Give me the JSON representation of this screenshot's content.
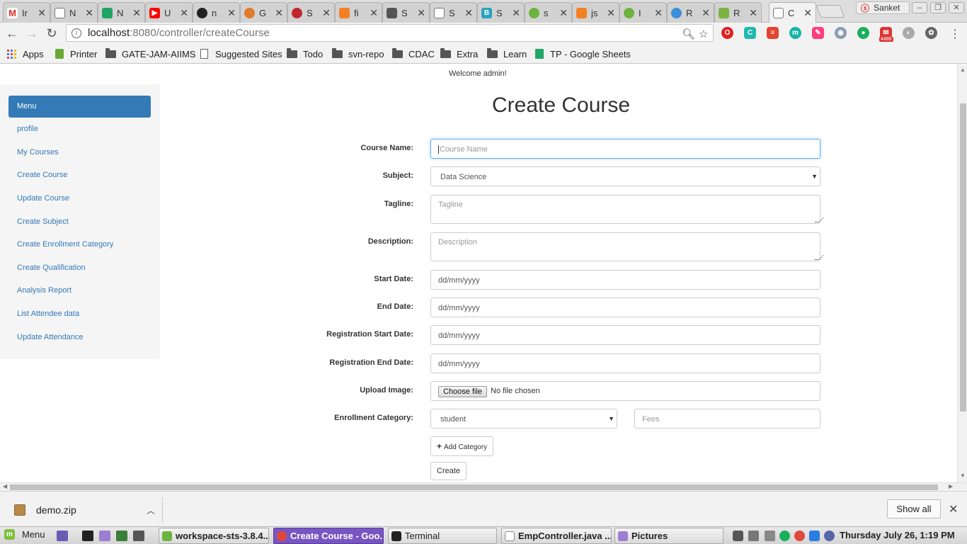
{
  "browser": {
    "tabs": [
      {
        "title": "Ir",
        "favicon": "gmail-icon",
        "color": "#d93025"
      },
      {
        "title": "N",
        "favicon": "page-icon",
        "color": "#888888"
      },
      {
        "title": "N",
        "favicon": "drive-icon",
        "color": "#1fa463"
      },
      {
        "title": "U",
        "favicon": "youtube-icon",
        "color": "#ff0000"
      },
      {
        "title": "n",
        "favicon": "github-icon",
        "color": "#222222"
      },
      {
        "title": "G",
        "favicon": "generic-icon",
        "color": "#e07b2a"
      },
      {
        "title": "S",
        "favicon": "generic-icon",
        "color": "#c0272d"
      },
      {
        "title": "fi",
        "favicon": "stackoverflow-icon",
        "color": "#f48024"
      },
      {
        "title": "S",
        "favicon": "generic-icon",
        "color": "#555555"
      },
      {
        "title": "S",
        "favicon": "page-icon",
        "color": "#888888"
      },
      {
        "title": "S",
        "favicon": "generic-icon",
        "color": "#2aa1c0"
      },
      {
        "title": "s",
        "favicon": "spring-icon",
        "color": "#6db33f"
      },
      {
        "title": "js",
        "favicon": "stackoverflow-icon",
        "color": "#f48024"
      },
      {
        "title": "I",
        "favicon": "spring-icon",
        "color": "#6db33f"
      },
      {
        "title": "R",
        "favicon": "generic-icon",
        "color": "#3b8fd8"
      },
      {
        "title": "R",
        "favicon": "generic-icon",
        "color": "#7cb342"
      },
      {
        "title": "C",
        "favicon": "page-icon",
        "color": "#888888"
      }
    ],
    "profile_name": "Sanket",
    "url_host": "localhost",
    "url_path": ":8080/controller/createCourse",
    "bookmarks": [
      {
        "label": "Apps",
        "icon": "apps-icon"
      },
      {
        "label": "Printer",
        "icon": "printer-icon"
      },
      {
        "label": "GATE-JAM-AIIMS",
        "icon": "folder-icon"
      },
      {
        "label": "Suggested Sites",
        "icon": "page-icon"
      },
      {
        "label": "Todo",
        "icon": "folder-icon"
      },
      {
        "label": "svn-repo",
        "icon": "folder-icon"
      },
      {
        "label": "CDAC",
        "icon": "folder-icon"
      },
      {
        "label": "Extra",
        "icon": "folder-icon"
      },
      {
        "label": "Learn",
        "icon": "folder-icon"
      },
      {
        "label": "TP - Google Sheets",
        "icon": "sheets-icon"
      }
    ],
    "mail_badge": "4488"
  },
  "page": {
    "welcome": "Welcome admin!",
    "title": "Create Course",
    "sidebar": {
      "header": "Menu",
      "links": [
        "profile",
        "My Courses",
        "Create Course",
        "Update Course",
        "Create Subject",
        "Create Enrollment Category",
        "Create Qualification",
        "Analysis Report",
        "List Attendee data",
        "Update Attendance"
      ]
    },
    "form": {
      "course_name_label": "Course Name:",
      "course_name_placeholder": "Course Name",
      "subject_label": "Subject:",
      "subject_value": "Data Science",
      "tagline_label": "Tagline:",
      "tagline_placeholder": "Tagline",
      "description_label": "Description:",
      "description_placeholder": "Description",
      "start_date_label": "Start Date:",
      "end_date_label": "End Date:",
      "reg_start_label": "Registration Start Date:",
      "reg_end_label": "Registration End Date:",
      "date_placeholder": "dd/mm/yyyy",
      "upload_label": "Upload Image:",
      "choose_file": "Choose file",
      "no_file": "No file chosen",
      "enrollment_label": "Enrollment Category:",
      "enrollment_value": "student",
      "fees_placeholder": "Fees",
      "add_category": "Add Category",
      "create": "Create"
    }
  },
  "downloads": {
    "file": "demo.zip",
    "show_all": "Show all"
  },
  "taskbar": {
    "menu": "Menu",
    "tasks": [
      "workspace-sts-3.8.4....",
      "Create Course - Goo...",
      "Terminal",
      "EmpController.java ...",
      "Pictures"
    ],
    "clock": "Thursday July 26, 1:19 PM"
  }
}
